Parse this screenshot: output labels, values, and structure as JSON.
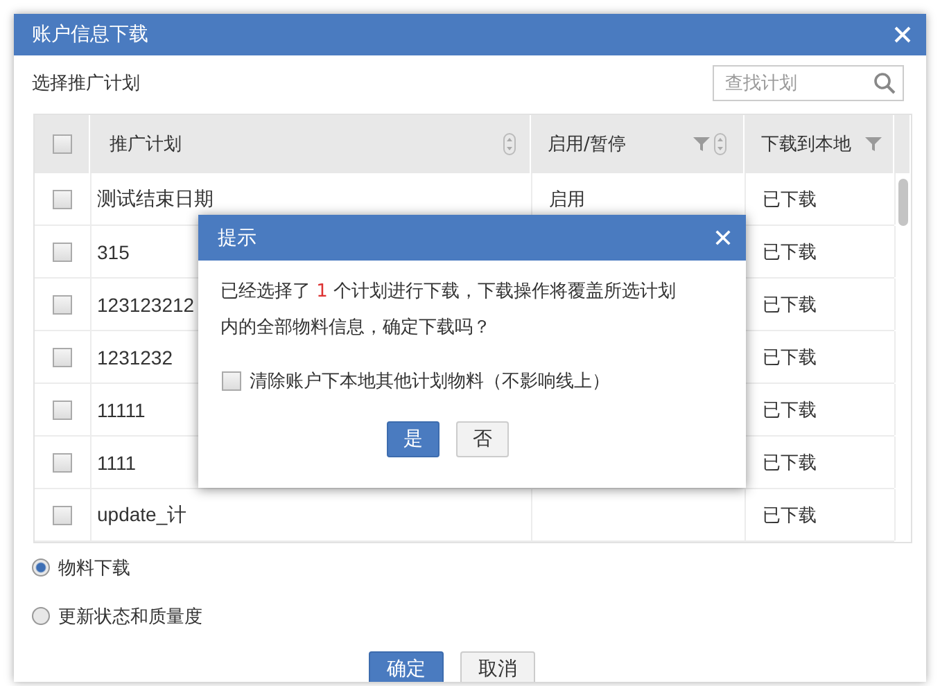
{
  "window": {
    "title": "账户信息下载"
  },
  "section_label": "选择推广计划",
  "search": {
    "placeholder": "查找计划"
  },
  "table": {
    "header_checked": false,
    "columns": [
      {
        "label": "推广计划",
        "sortable": true,
        "filterable": false
      },
      {
        "label": "启用/暂停",
        "sortable": true,
        "filterable": true
      },
      {
        "label": "下载到本地",
        "sortable": false,
        "filterable": true
      }
    ],
    "rows": [
      {
        "checked": false,
        "plan": "测试结束日期",
        "status": "启用",
        "download": "已下载"
      },
      {
        "checked": false,
        "plan": "315",
        "download": "已下载"
      },
      {
        "checked": false,
        "plan": "123123212",
        "download": "已下载"
      },
      {
        "checked": false,
        "plan": "1231232",
        "download": "已下载"
      },
      {
        "checked": false,
        "plan": "11111",
        "download": "已下载"
      },
      {
        "checked": false,
        "plan": "1111",
        "download": "已下载"
      },
      {
        "checked": false,
        "plan": "update_计",
        "download": "已下载"
      }
    ]
  },
  "modes": [
    {
      "label": "物料下载",
      "selected": true
    },
    {
      "label": "更新状态和质量度",
      "selected": false
    }
  ],
  "buttons": [
    {
      "label": "确定",
      "kind": "primary"
    },
    {
      "label": "取消",
      "kind": "secondary"
    }
  ],
  "prompt": {
    "title": "提示",
    "message_before": "已经选择了",
    "count": "1",
    "message_after": "个计划进行下载，下载操作将覆盖所选计划内的全部物料信息，确定下载吗？",
    "option": {
      "label": "清除账户下本地其他计划物料（不影响线上）",
      "checked": false
    },
    "buttons": [
      {
        "label": "是",
        "kind": "primary"
      },
      {
        "label": "否",
        "kind": "secondary"
      }
    ]
  }
}
